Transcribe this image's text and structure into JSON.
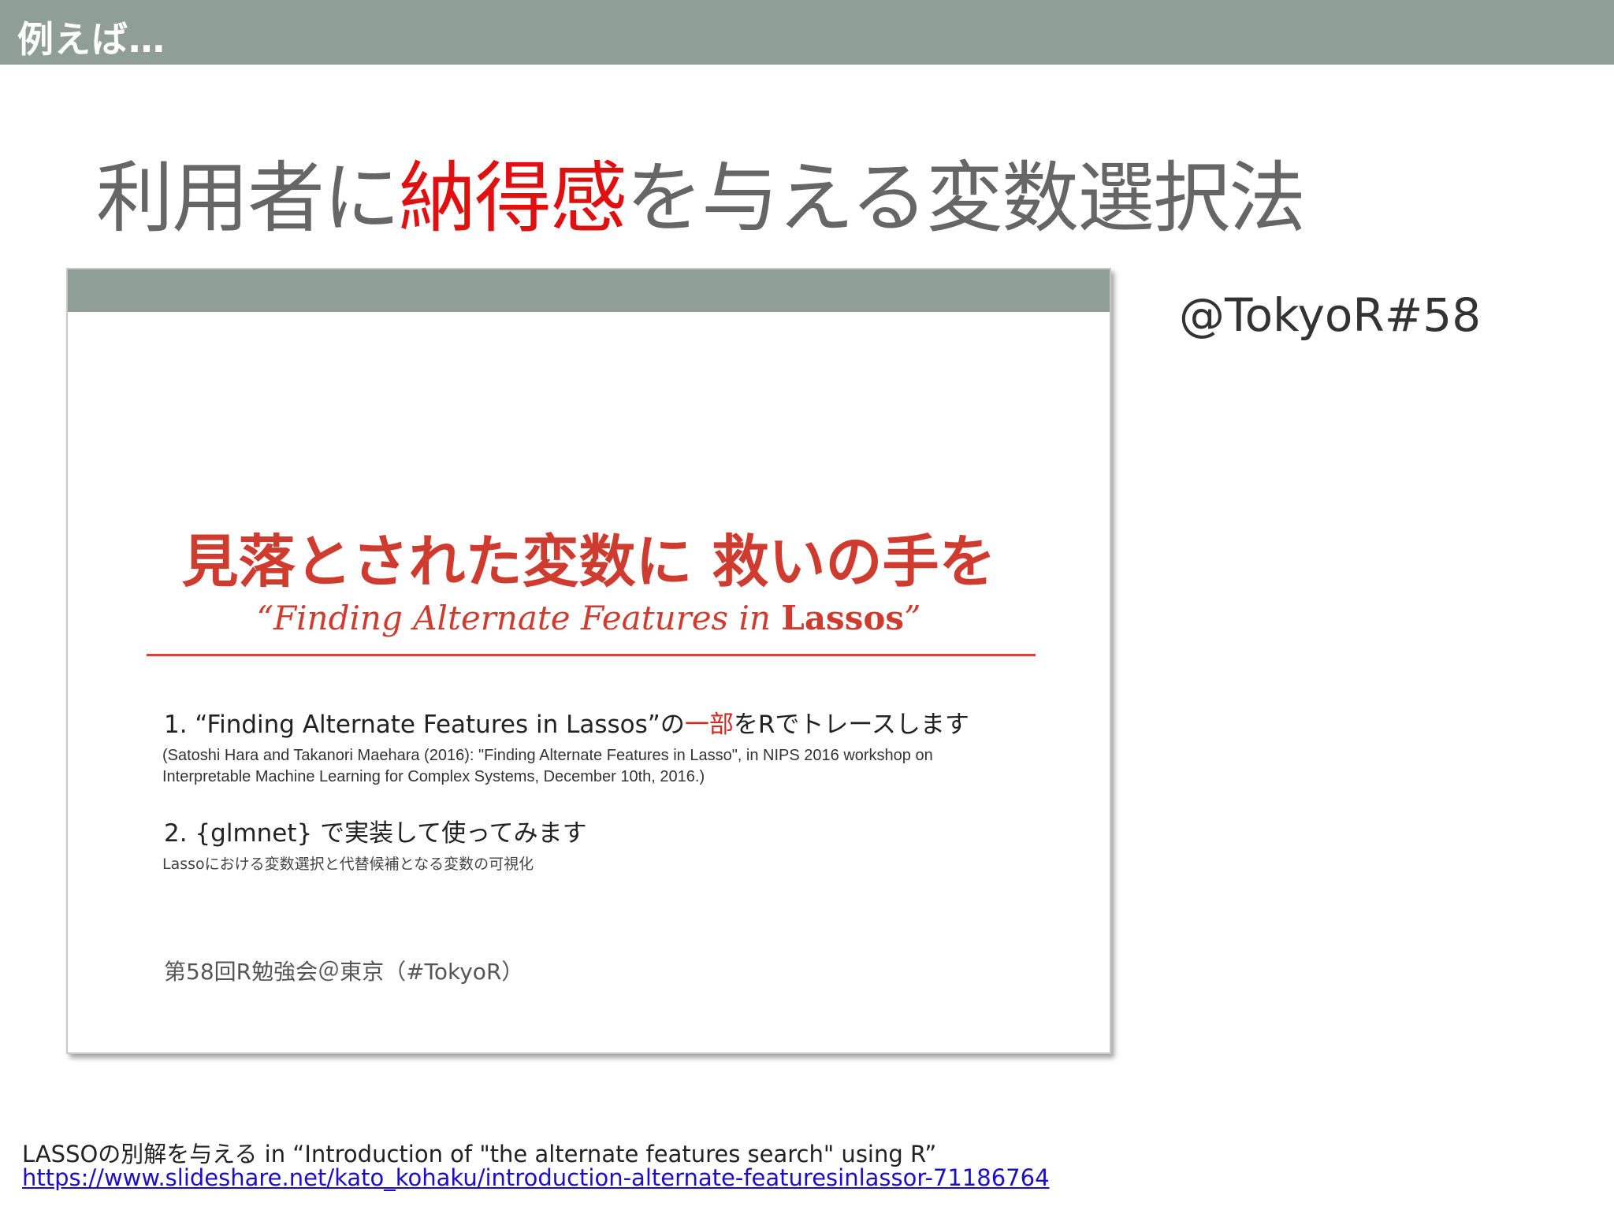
{
  "header": {
    "title": "例えば…"
  },
  "headline": {
    "part1": "利用者に",
    "accent": "納得感",
    "part2": "を与える変数選択法"
  },
  "event_tag": "@TokyoR#58",
  "embedded_slide": {
    "title": "見落とされた変数に 救いの手を",
    "subtitle_main": "“Finding Alternate Features in ",
    "subtitle_bold": "Lassos",
    "subtitle_end": "”",
    "item1": {
      "prefix": "1. “Finding Alternate Features in Lassos”の",
      "highlight": "一部",
      "suffix": "をRでトレースします"
    },
    "citation_line1": "(Satoshi Hara and Takanori Maehara (2016): \"Finding Alternate Features in Lasso\", in NIPS 2016 workshop on",
    "citation_line2": "Interpretable Machine Learning for Complex Systems, December 10th, 2016.)",
    "item2": "2. {glmnet} で実装して使ってみます",
    "item2_sub": "Lassoにおける変数選択と代替候補となる変数の可視化",
    "footer": "第58回R勉強会＠東京（#TokyoR）"
  },
  "source": {
    "caption": "LASSOの別解を与える  in  “Introduction of \"the alternate features search\" using R”",
    "url": "https://www.slideshare.net/kato_kohaku/introduction-alternate-featuresinlassor-71186764"
  },
  "colors": {
    "header_bar": "#8f9e96",
    "accent_red": "#e01010",
    "link_blue": "#1a0dcc"
  }
}
